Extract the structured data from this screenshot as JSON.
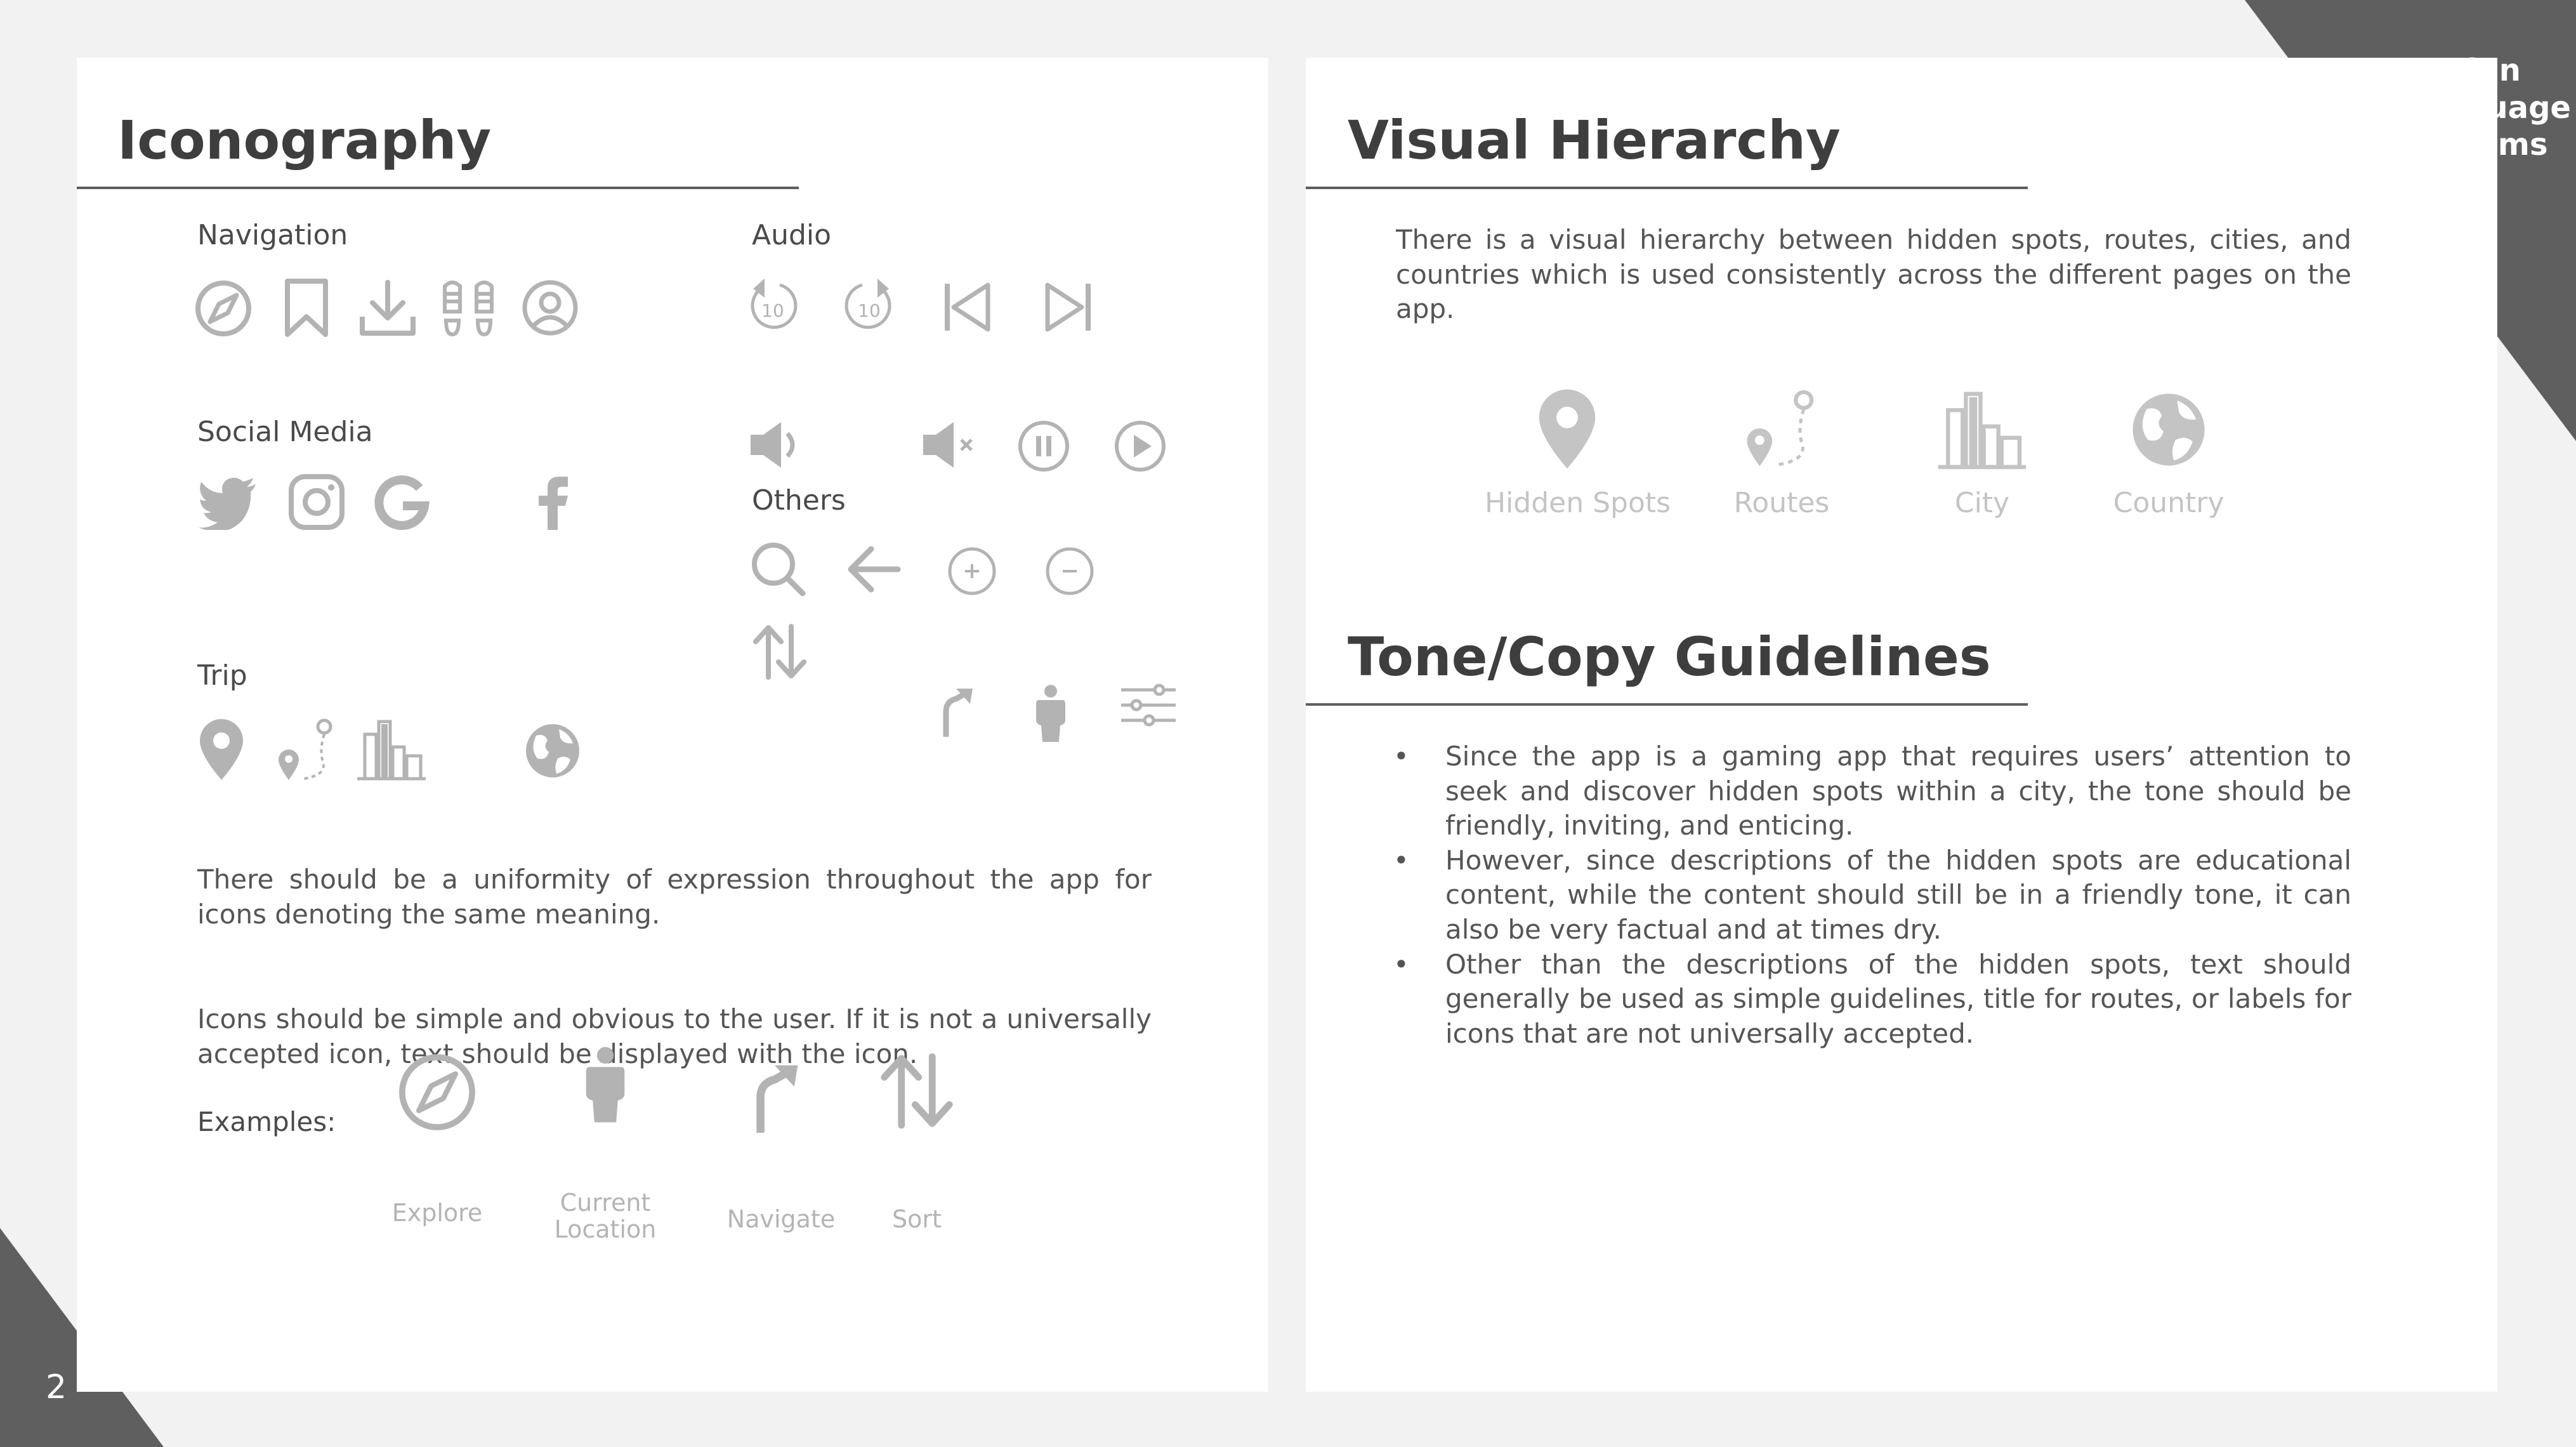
{
  "brand": {
    "line1": "Design",
    "line2": "Language",
    "line3": "Systems"
  },
  "page_number": "2",
  "iconography": {
    "title": "Iconography",
    "navigation": {
      "label": "Navigation",
      "icons": [
        "compass-icon",
        "bookmark-icon",
        "download-icon",
        "footprints-icon",
        "user-profile-icon"
      ]
    },
    "audio": {
      "label": "Audio",
      "icons": [
        "rewind-10-icon",
        "forward-10-icon",
        "skip-back-icon",
        "skip-forward-icon",
        "volume-icon",
        "mute-icon",
        "pause-icon",
        "play-icon"
      ]
    },
    "social_media": {
      "label": "Social Media",
      "icons": [
        "twitter-icon",
        "instagram-icon",
        "google-icon",
        "facebook-icon"
      ]
    },
    "others": {
      "label": "Others",
      "icons": [
        "search-icon",
        "arrow-left-icon",
        "zoom-in-icon",
        "zoom-out-icon",
        "sort-icon",
        "navigate-icon",
        "person-icon",
        "sliders-icon"
      ]
    },
    "trip": {
      "label": "Trip",
      "icons": [
        "map-pin-icon",
        "route-icon",
        "city-icon",
        "globe-icon"
      ]
    },
    "paragraph1": "There should be a uniformity of expression throughout the app for icons denoting the same meaning.",
    "paragraph2": "Icons should be simple and obvious to the user. If it is not a universally accepted icon, text should be displayed with the icon.",
    "examples_label": "Examples:",
    "examples": [
      {
        "icon": "compass-icon",
        "line1": "Explore",
        "line2": ""
      },
      {
        "icon": "person-icon",
        "line1": "Current",
        "line2": "Location"
      },
      {
        "icon": "navigate-icon",
        "line1": "Navigate",
        "line2": ""
      },
      {
        "icon": "sort-icon",
        "line1": "Sort",
        "line2": ""
      }
    ]
  },
  "visual_hierarchy": {
    "title": "Visual Hierarchy",
    "paragraph": "There is a visual hierarchy between hidden spots, routes, cities, and countries which is used consistently across the different pages on the app.",
    "items": [
      {
        "icon": "map-pin-icon",
        "label": "Hidden Spots"
      },
      {
        "icon": "route-icon",
        "label": "Routes"
      },
      {
        "icon": "city-icon",
        "label": "City"
      },
      {
        "icon": "globe-icon",
        "label": "Country"
      }
    ]
  },
  "tone": {
    "title": "Tone/Copy Guidelines",
    "bullets": [
      "Since the app is a gaming app that requires users’ attention to seek and discover hidden spots within a city, the tone should be friendly, inviting, and enticing.",
      "However, since descriptions of the hidden spots are educational content, while the content should still be in a friendly tone, it can also be very factual and at times dry.",
      "Other than the descriptions of the hidden spots, text should generally be used as simple guidelines, title for routes, or labels for icons that are not universally accepted."
    ]
  },
  "colors": {
    "background": "#f2f2f2",
    "panel": "#ffffff",
    "accent_dark": "#5f5f5f",
    "icon_gray": "#b3b3b3",
    "caption_gray": "#c4c4c4"
  }
}
